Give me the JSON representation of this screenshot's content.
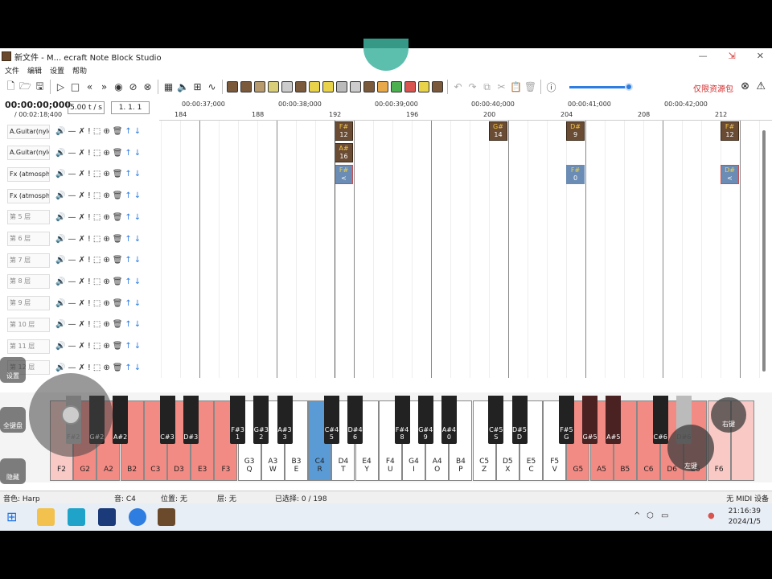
{
  "window": {
    "title": "新文件 - M... ecraft Note Block Studio",
    "controls": [
      "—",
      "⇲",
      "✕"
    ]
  },
  "menu": [
    "文件",
    "编辑",
    "设置",
    "帮助"
  ],
  "toolbar": {
    "resource_pack": "仅限资源包"
  },
  "transport": {
    "time": "00:00:00;000",
    "total": "/ 00:02:18;400",
    "tempo": "5.00 t / s",
    "position": "1. 1. 1"
  },
  "ruler": {
    "times": [
      "00:00:37;000",
      "00:00:38;000",
      "00:00:39;000",
      "00:00:40;000",
      "00:00:41;000",
      "00:00:42;000"
    ],
    "bars": [
      "184",
      "188",
      "192",
      "196",
      "200",
      "204",
      "208",
      "212"
    ]
  },
  "layers": [
    {
      "name": "A.Guitar(nylo",
      "dim": false
    },
    {
      "name": "A.Guitar(nylo",
      "dim": false
    },
    {
      "name": "Fx (atmosph.)",
      "dim": false
    },
    {
      "name": "Fx (atmosph.)",
      "dim": false
    },
    {
      "name": "第 5 层",
      "dim": true
    },
    {
      "name": "第 6 层",
      "dim": true
    },
    {
      "name": "第 7 层",
      "dim": true
    },
    {
      "name": "第 8 层",
      "dim": true
    },
    {
      "name": "第 9 层",
      "dim": true
    },
    {
      "name": "第 10 层",
      "dim": true
    },
    {
      "name": "第 11 层",
      "dim": true
    },
    {
      "name": "第 12 层",
      "dim": true
    }
  ],
  "notes": [
    {
      "key": "F#",
      "val": "12",
      "layer": 0,
      "bar": 192,
      "type": "guitar"
    },
    {
      "key": "A#",
      "val": "16",
      "layer": 1,
      "bar": 192,
      "type": "guitar"
    },
    {
      "key": "F#",
      "val": "<",
      "layer": 2,
      "bar": 192,
      "type": "fx"
    },
    {
      "key": "G#",
      "val": "14",
      "layer": 0,
      "bar": 200,
      "type": "guitar"
    },
    {
      "key": "D#",
      "val": "9",
      "layer": 0,
      "bar": 204,
      "type": "guitar"
    },
    {
      "key": "F#",
      "val": "0",
      "layer": 2,
      "bar": 204,
      "type": "fxplain"
    },
    {
      "key": "F#",
      "val": "12",
      "layer": 0,
      "bar": 212,
      "type": "guitar"
    },
    {
      "key": "D#",
      "val": "<",
      "layer": 2,
      "bar": 212,
      "type": "fx"
    }
  ],
  "white_keys": [
    {
      "n": "F2",
      "s": "",
      "c": "pink"
    },
    {
      "n": "G2",
      "s": "",
      "c": "red"
    },
    {
      "n": "A2",
      "s": "",
      "c": "red"
    },
    {
      "n": "B2",
      "s": "",
      "c": "red"
    },
    {
      "n": "C3",
      "s": "",
      "c": "red"
    },
    {
      "n": "D3",
      "s": "",
      "c": "red"
    },
    {
      "n": "E3",
      "s": "",
      "c": "red"
    },
    {
      "n": "F3",
      "s": "",
      "c": "red"
    },
    {
      "n": "G3",
      "s": "Q",
      "c": ""
    },
    {
      "n": "A3",
      "s": "W",
      "c": ""
    },
    {
      "n": "B3",
      "s": "E",
      "c": ""
    },
    {
      "n": "C4",
      "s": "R",
      "c": "sel"
    },
    {
      "n": "D4",
      "s": "T",
      "c": ""
    },
    {
      "n": "E4",
      "s": "Y",
      "c": ""
    },
    {
      "n": "F4",
      "s": "U",
      "c": ""
    },
    {
      "n": "G4",
      "s": "I",
      "c": ""
    },
    {
      "n": "A4",
      "s": "O",
      "c": ""
    },
    {
      "n": "B4",
      "s": "P",
      "c": ""
    },
    {
      "n": "C5",
      "s": "Z",
      "c": ""
    },
    {
      "n": "D5",
      "s": "X",
      "c": ""
    },
    {
      "n": "E5",
      "s": "C",
      "c": ""
    },
    {
      "n": "F5",
      "s": "V",
      "c": ""
    },
    {
      "n": "G5",
      "s": "",
      "c": "red"
    },
    {
      "n": "A5",
      "s": "",
      "c": "red"
    },
    {
      "n": "B5",
      "s": "",
      "c": "red"
    },
    {
      "n": "C6",
      "s": "",
      "c": "red"
    },
    {
      "n": "D6",
      "s": "",
      "c": "red"
    },
    {
      "n": "E6",
      "s": "",
      "c": "red"
    },
    {
      "n": "F6",
      "s": "",
      "c": "pink"
    },
    {
      "n": "",
      "s": "",
      "c": "pink"
    }
  ],
  "black_keys": [
    {
      "n": "F#2",
      "s": "",
      "c": "gray",
      "after": 0
    },
    {
      "n": "G#2",
      "s": "",
      "c": "",
      "after": 1
    },
    {
      "n": "A#2",
      "s": "",
      "c": "",
      "after": 2
    },
    {
      "n": "C#3",
      "s": "",
      "c": "",
      "after": 4
    },
    {
      "n": "D#3",
      "s": "",
      "c": "",
      "after": 5
    },
    {
      "n": "F#3",
      "s": "1",
      "c": "",
      "after": 7
    },
    {
      "n": "G#3",
      "s": "2",
      "c": "",
      "after": 8
    },
    {
      "n": "A#3",
      "s": "3",
      "c": "",
      "after": 9
    },
    {
      "n": "C#4",
      "s": "5",
      "c": "",
      "after": 11
    },
    {
      "n": "D#4",
      "s": "6",
      "c": "",
      "after": 12
    },
    {
      "n": "F#4",
      "s": "8",
      "c": "",
      "after": 14
    },
    {
      "n": "G#4",
      "s": "9",
      "c": "",
      "after": 15
    },
    {
      "n": "A#4",
      "s": "0",
      "c": "",
      "after": 16
    },
    {
      "n": "C#5",
      "s": "S",
      "c": "",
      "after": 18
    },
    {
      "n": "D#5",
      "s": "D",
      "c": "",
      "after": 19
    },
    {
      "n": "F#5",
      "s": "G",
      "c": "",
      "after": 21
    },
    {
      "n": "G#5",
      "s": "",
      "c": "dred",
      "after": 22
    },
    {
      "n": "A#5",
      "s": "",
      "c": "dred",
      "after": 23
    },
    {
      "n": "C#6",
      "s": "",
      "c": "",
      "after": 25
    },
    {
      "n": "D#6",
      "s": "",
      "c": "gray",
      "after": 26
    }
  ],
  "status": {
    "instrument": "音色: Harp",
    "note": "音: C4",
    "position": "位置: 无",
    "layer": "层: 无",
    "selected": "已选择: 0 / 198",
    "midi": "无 MIDI 设备"
  },
  "overlay": {
    "settings": "设置",
    "keyboard": "全键盘",
    "hide": "隐藏",
    "right": "右键",
    "left": "左键"
  },
  "clock": {
    "time": "21:16:39",
    "date": "2024/1/5"
  },
  "colors": {
    "accent": "#2e7de1",
    "note_guitar": "#6a4b33",
    "note_fx": "#6b8db5",
    "key_red": "#f28b84",
    "key_selected": "#5b9bd5"
  }
}
